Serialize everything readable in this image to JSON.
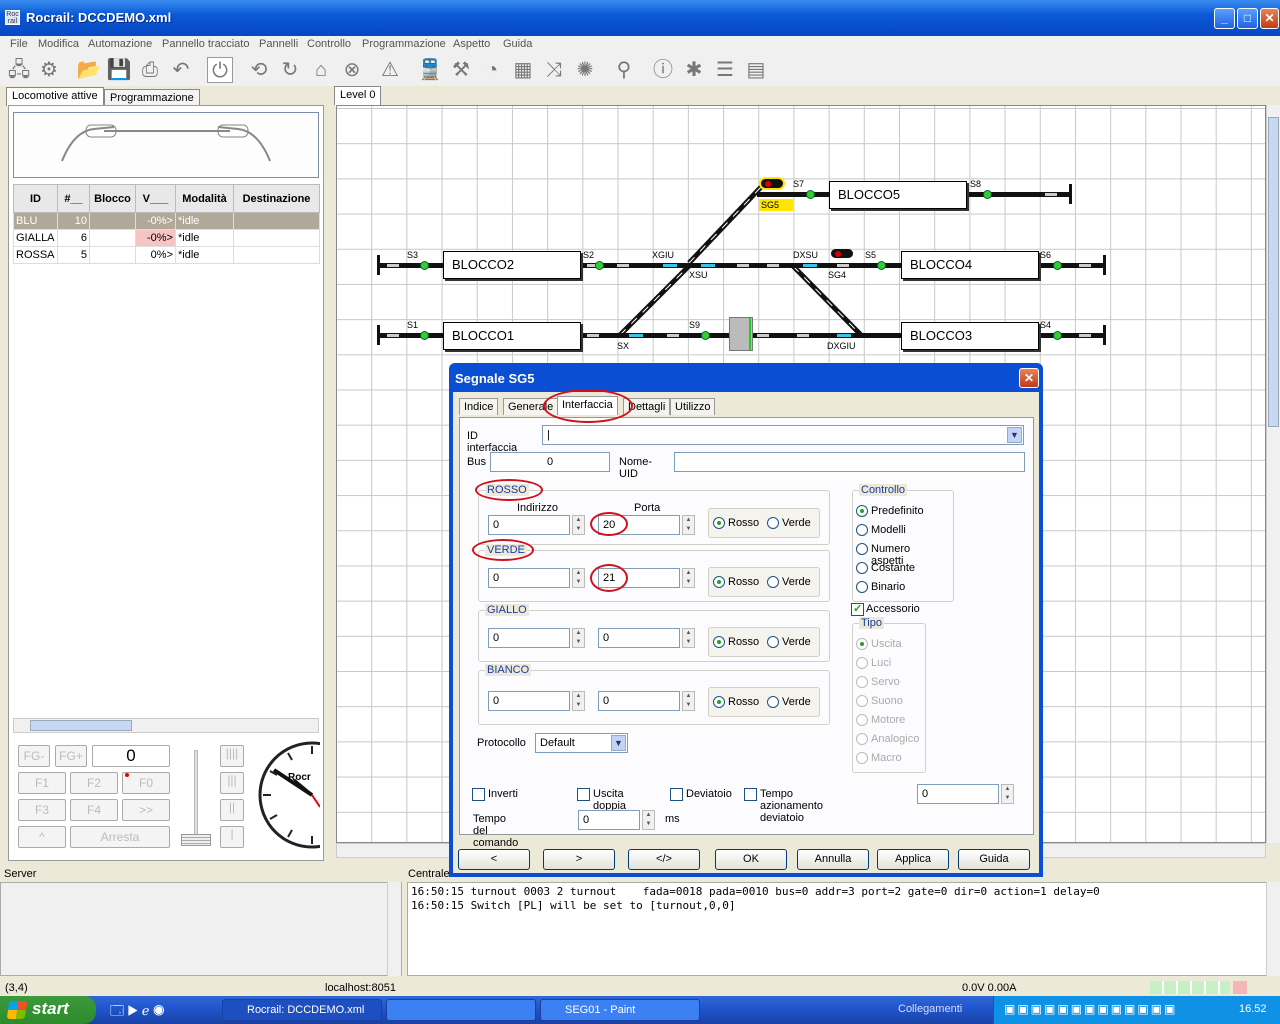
{
  "window": {
    "title": "Rocrail: DCCDEMO.xml",
    "icon_label": "Roc rail"
  },
  "menu": [
    "File",
    "Modifica",
    "Automazione",
    "Pannello tracciato",
    "Pannelli",
    "Controllo",
    "Programmazione",
    "Aspetto",
    "Guida"
  ],
  "left_tabs": [
    "Locomotive attive",
    "Programmazione"
  ],
  "loco_table": {
    "headers": [
      "ID",
      "#__",
      "Blocco",
      "V___",
      "Modalità",
      "Destinazione"
    ],
    "rows": [
      {
        "id": "BLU",
        "num": "10",
        "block": "",
        "v": "-0%>",
        "mode": "*idle",
        "dest": ""
      },
      {
        "id": "GIALLA",
        "num": "6",
        "block": "",
        "v": "-0%>",
        "mode": "*idle",
        "dest": ""
      },
      {
        "id": "ROSSA",
        "num": "5",
        "block": "",
        "v": "0%>",
        "mode": "*idle",
        "dest": ""
      }
    ]
  },
  "throttle": {
    "fg_minus": "FG-",
    "fg_plus": "FG+",
    "speed": "0",
    "f1": "F1",
    "f2": "F2",
    "f0": "F0",
    "f3": "F3",
    "f4": "F4",
    "more": ">>",
    "up": "^",
    "stop": "Arresta",
    "clock_brand": "Rocr"
  },
  "level_tab": "Level 0",
  "track": {
    "blocks": [
      "BLOCCO5",
      "BLOCCO2",
      "BLOCCO4",
      "BLOCCO1",
      "BLOCCO3"
    ],
    "labels": {
      "s7": "S7",
      "s8": "S8",
      "sg5": "SG5",
      "s3": "S3",
      "s2": "S2",
      "xgiu": "XGIU",
      "dxsu": "DXSU",
      "s5": "S5",
      "s6": "S6",
      "xsu": "XSU",
      "sg4": "SG4",
      "s1": "S1",
      "s9": "S9",
      "s4": "S4",
      "sx": "SX",
      "dxgiu": "DXGIU"
    }
  },
  "dialog": {
    "title": "Segnale SG5",
    "tabs": [
      "Indice",
      "Generale",
      "Interfaccia",
      "Dettagli",
      "Utilizzo"
    ],
    "id_interfaccia_label": "ID interfaccia",
    "id_interfaccia_value": "|",
    "bus_label": "Bus",
    "bus_value": "0",
    "uid_label": "Nome-UID",
    "uid_value": "",
    "indirizzo_label": "Indirizzo",
    "porta_label": "Porta",
    "groups": [
      {
        "name": "ROSSO",
        "addr": "0",
        "port": "20"
      },
      {
        "name": "VERDE",
        "addr": "0",
        "port": "21"
      },
      {
        "name": "GIALLO",
        "addr": "0",
        "port": "0"
      },
      {
        "name": "BIANCO",
        "addr": "0",
        "port": "0"
      }
    ],
    "rosso_opt": "Rosso",
    "verde_opt": "Verde",
    "controllo_label": "Controllo",
    "controllo_options": [
      "Predefinito",
      "Modelli",
      "Numero aspetti",
      "Costante",
      "Binario"
    ],
    "accessorio_label": "Accessorio",
    "tipo_label": "Tipo",
    "tipo_options": [
      "Uscita",
      "Luci",
      "Servo",
      "Suono",
      "Motore",
      "Analogico",
      "Macro"
    ],
    "protocollo_label": "Protocollo",
    "protocollo_value": "Default",
    "inverti": "Inverti",
    "uscita_doppia": "Uscita doppia",
    "deviatoio": "Deviatoio",
    "tempo_azionamento": "Tempo azionamento deviatoio",
    "tempo_azionamento_value": "0",
    "tempo_comando_label": "Tempo del comando",
    "tempo_comando_value": "0",
    "ms": "ms",
    "buttons": [
      "<",
      ">",
      "</>",
      "OK",
      "Annulla",
      "Applica",
      "Guida"
    ]
  },
  "bottom": {
    "server_label": "Server",
    "centrale_label": "Centrale",
    "log": [
      "16:50:15 turnout 0003 2 turnout    fada=0018 pada=0010 bus=0 addr=3 port=2 gate=0 dir=0 action=1 delay=0",
      "16:50:15 Switch [PL] will be set to [turnout,0,0]"
    ]
  },
  "status": {
    "coords": "(3,4)",
    "host": "localhost:8051",
    "power": "0.0V 0.00A"
  },
  "taskbar": {
    "start": "start",
    "tasks": [
      "Rocrail: DCCDEMO.xml",
      "",
      "SEG01 - Paint"
    ],
    "links": "Collegamenti",
    "time": "16.52"
  },
  "colors": {
    "title_blue": "#0a5ad6",
    "highlight_red": "#d0101a",
    "signal_green": "#33cc33",
    "track_blue": "#33c6e6"
  }
}
